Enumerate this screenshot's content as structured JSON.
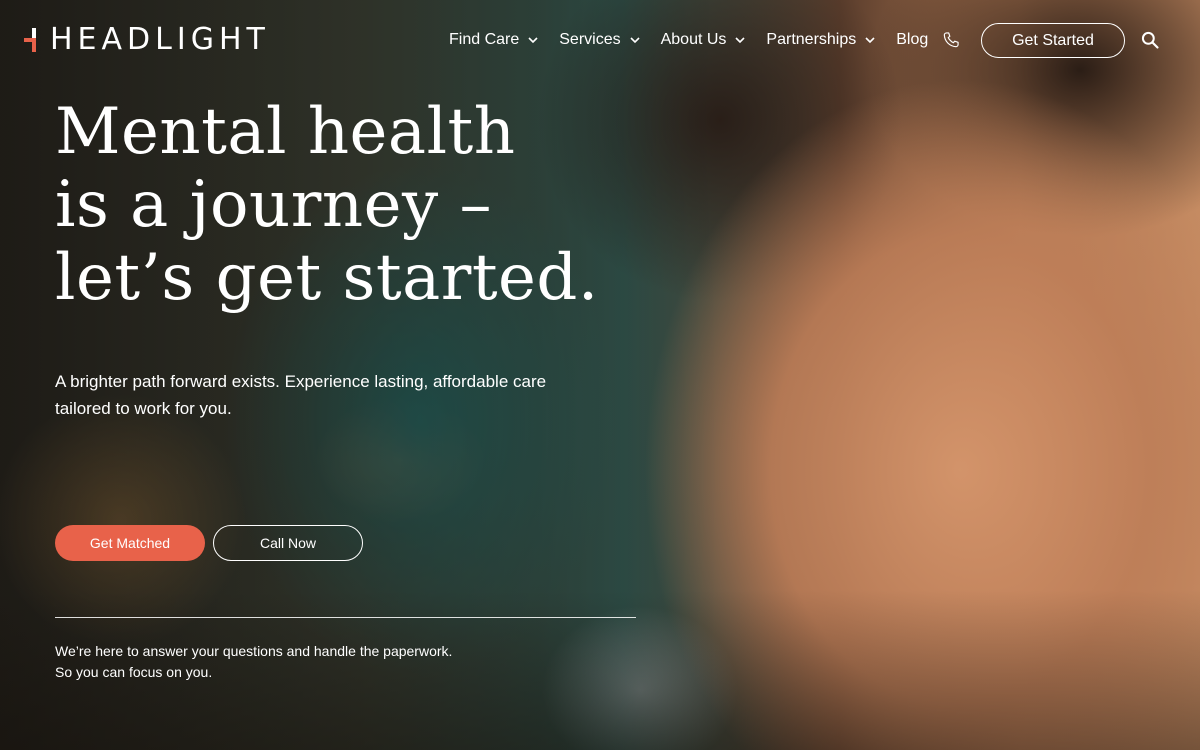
{
  "brand": {
    "name": "HEADLIGHT",
    "accent": "#e8624a"
  },
  "nav": {
    "items": [
      {
        "label": "Find Care",
        "has_dropdown": true
      },
      {
        "label": "Services",
        "has_dropdown": true
      },
      {
        "label": "About Us",
        "has_dropdown": true
      },
      {
        "label": "Partnerships",
        "has_dropdown": true
      },
      {
        "label": "Blog",
        "has_dropdown": false
      }
    ],
    "phone_icon": "phone-icon",
    "cta_label": "Get Started",
    "search_icon": "search-icon"
  },
  "hero": {
    "headline_lines": [
      "Mental health",
      "is a journey –",
      "let’s get started."
    ],
    "lead": "A brighter path forward exists. Experience lasting, affordable care tailored to work for you.",
    "primary_button": "Get Matched",
    "secondary_button": "Call Now",
    "footnote_lines": [
      "We’re here to answer your questions and handle the paperwork.",
      "So you can focus on you."
    ]
  }
}
